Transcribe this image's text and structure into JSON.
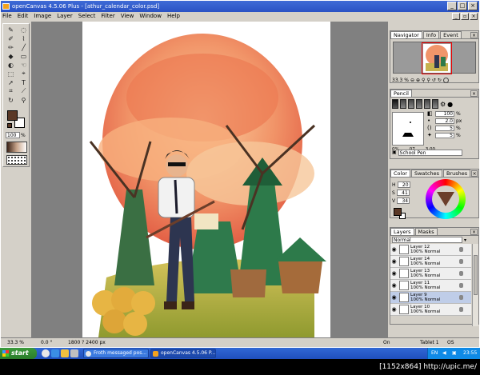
{
  "window": {
    "title": "openCanvas 4.5.06 Plus - [athur_calendar_color.psd]"
  },
  "menu": [
    "File",
    "Edit",
    "Image",
    "Layer",
    "Select",
    "Filter",
    "View",
    "Window",
    "Help"
  ],
  "toolbox": {
    "zoom_value": "100",
    "zoom_unit": "%"
  },
  "navigator": {
    "tabs": [
      "Navigator",
      "Info",
      "Event"
    ],
    "zoom": "33.3 %"
  },
  "pen": {
    "tab": "Pencil",
    "params": [
      {
        "icon": "opacity-icon",
        "value": "100",
        "unit": "%"
      },
      {
        "icon": "size-icon",
        "value": "2.0",
        "unit": "px"
      },
      {
        "icon": "density-icon",
        "value": "5",
        "unit": "%"
      },
      {
        "icon": "blur-icon",
        "value": "5",
        "unit": "%"
      }
    ],
    "preview_values": [
      "0%",
      "07",
      "3.00"
    ],
    "brush_name": "School Pen"
  },
  "color": {
    "tabs": [
      "Color",
      "Swatches",
      "Brushes"
    ],
    "h": "20",
    "s": "41",
    "v": "34",
    "fg": "#5a3826"
  },
  "layers": {
    "tabs": [
      "Layers",
      "Masks"
    ],
    "blend_mode": "Normal",
    "rows": [
      {
        "name": "Layer 12",
        "info": "100% Normal",
        "selected": false
      },
      {
        "name": "Layer 14",
        "info": "100% Normal",
        "selected": false
      },
      {
        "name": "Layer 13",
        "info": "100% Normal",
        "selected": false
      },
      {
        "name": "Layer 11",
        "info": "100% Normal",
        "selected": false
      },
      {
        "name": "Layer 9",
        "info": "100% Normal",
        "selected": true
      },
      {
        "name": "Layer 10",
        "info": "100% Normal",
        "selected": false
      }
    ]
  },
  "status": {
    "zoom": "33.3 %",
    "angle": "0.0 °",
    "size": "1800 ? 2400 px",
    "on": "On",
    "tablet": "Tablet 1",
    "coords": "OS Coordinates"
  },
  "taskbar": {
    "start": "start",
    "tasks": [
      "Froth messaged pos...",
      "openCanvas 4.5.06 P..."
    ],
    "lang": "EN",
    "time": "23:55"
  },
  "watermark": "[1152x864] http://upic.me/"
}
